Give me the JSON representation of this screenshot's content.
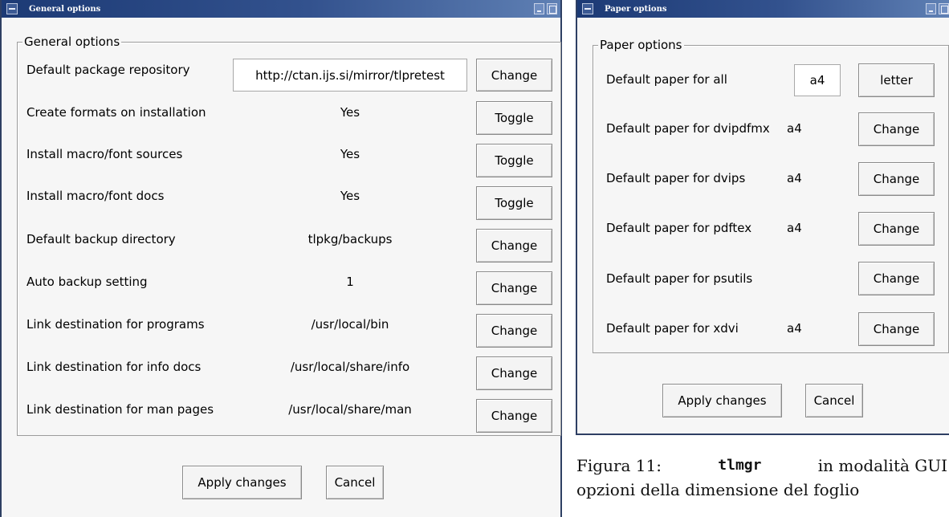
{
  "general": {
    "title": "General options",
    "group_label": "General options",
    "rows": [
      {
        "label": "Default package repository",
        "value": "http://ctan.ijs.si/mirror/tlpretest",
        "button": "Change"
      },
      {
        "label": "Create formats on installation",
        "value": "Yes",
        "button": "Toggle"
      },
      {
        "label": "Install macro/font sources",
        "value": "Yes",
        "button": "Toggle"
      },
      {
        "label": "Install macro/font docs",
        "value": "Yes",
        "button": "Toggle"
      },
      {
        "label": "Default backup directory",
        "value": "tlpkg/backups",
        "button": "Change"
      },
      {
        "label": "Auto backup setting",
        "value": "1",
        "button": "Change"
      },
      {
        "label": "Link destination for programs",
        "value": "/usr/local/bin",
        "button": "Change"
      },
      {
        "label": "Link destination for info docs",
        "value": "/usr/local/share/info",
        "button": "Change"
      },
      {
        "label": "Link destination for man pages",
        "value": "/usr/local/share/man",
        "button": "Change"
      }
    ],
    "apply": "Apply changes",
    "cancel": "Cancel"
  },
  "paper": {
    "title": "Paper options",
    "group_label": "Paper options",
    "all": {
      "label": "Default paper for all",
      "opt_a4": "a4",
      "opt_letter": "letter"
    },
    "rows": [
      {
        "label": "Default paper for dvipdfmx",
        "value": "a4",
        "button": "Change"
      },
      {
        "label": "Default paper for dvips",
        "value": "a4",
        "button": "Change"
      },
      {
        "label": "Default paper for pdftex",
        "value": "a4",
        "button": "Change"
      },
      {
        "label": "Default paper for psutils",
        "value": "",
        "button": "Change"
      },
      {
        "label": "Default paper for xdvi",
        "value": "a4",
        "button": "Change"
      }
    ],
    "apply": "Apply changes",
    "cancel": "Cancel"
  },
  "caption": {
    "prefix": "Figura 11:",
    "command": "tlmgr",
    "line1_rest": "in modalità GUI",
    "line2": "opzioni della dimensione del foglio"
  }
}
